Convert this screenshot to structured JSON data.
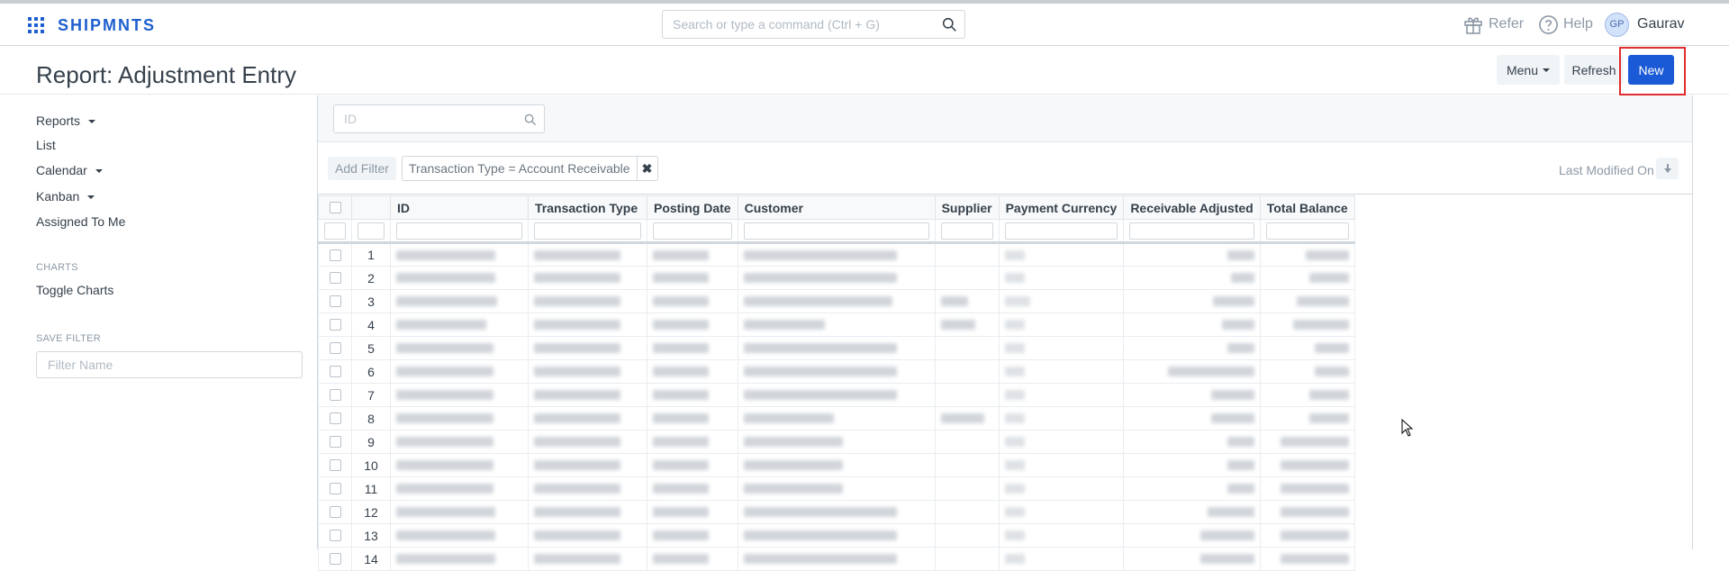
{
  "navbar": {
    "brand": "SHIPMNTS",
    "search_placeholder": "Search or type a command (Ctrl + G)",
    "refer_label": "Refer",
    "help_label": "Help",
    "user_initials": "GP",
    "user_name": "Gaurav",
    "brand_color": "#1f5fcf"
  },
  "page": {
    "title": "Report: Adjustment Entry",
    "menu_label": "Menu",
    "refresh_label": "Refresh",
    "new_label": "New",
    "primary_color": "#1a5ad6",
    "highlight_color": "#e02d2d"
  },
  "sidebar": {
    "items": [
      {
        "label": "Reports",
        "dropdown": true
      },
      {
        "label": "List",
        "dropdown": false
      },
      {
        "label": "Calendar",
        "dropdown": true
      },
      {
        "label": "Kanban",
        "dropdown": true
      },
      {
        "label": "Assigned To Me",
        "dropdown": false
      }
    ],
    "charts_heading": "CHARTS",
    "toggle_charts": "Toggle Charts",
    "save_filter_heading": "SAVE FILTER",
    "filter_name_placeholder": "Filter Name"
  },
  "report": {
    "id_placeholder": "ID",
    "add_filter_label": "Add Filter",
    "active_filter": "Transaction Type = Account Receivable",
    "sort_label": "Last Modified On",
    "columns": [
      "ID",
      "Transaction Type",
      "Posting Date",
      "Customer",
      "Supplier",
      "Payment Currency",
      "Receivable Adjusted",
      "Total Balance"
    ],
    "row_numbers": [
      "1",
      "2",
      "3",
      "4",
      "5",
      "6",
      "7",
      "8",
      "9",
      "10",
      "11",
      "12",
      "13",
      "14"
    ]
  }
}
